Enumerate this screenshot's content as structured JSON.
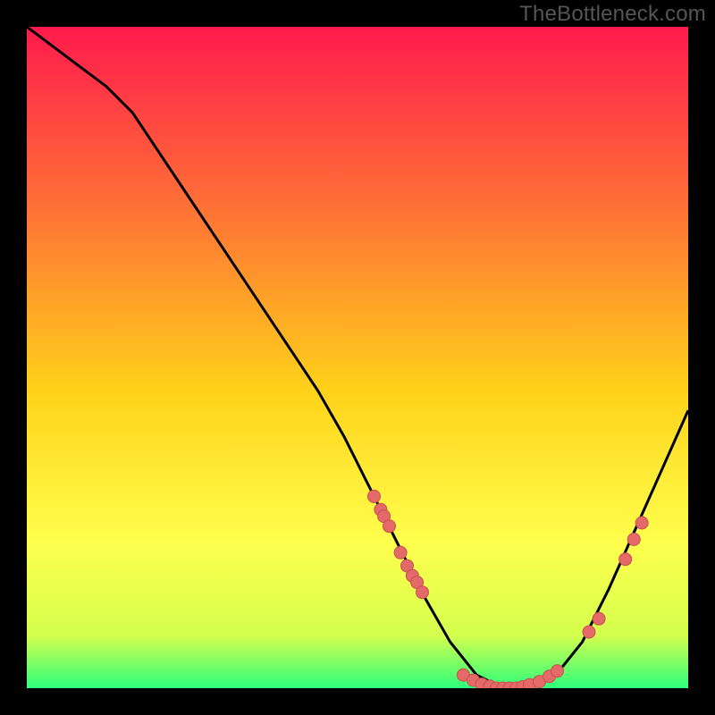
{
  "watermark": "TheBottleneck.com",
  "colors": {
    "bg": "#000000",
    "grad_top": "#ff1a4d",
    "grad_mid1": "#ff7a33",
    "grad_mid2": "#ffd21a",
    "grad_low": "#ffff4d",
    "grad_bottom1": "#d4ff4d",
    "grad_bottom2": "#2eff7a",
    "curve": "#000000",
    "dot_fill": "#e46a6a",
    "dot_stroke": "#c94f4f"
  },
  "chart_data": {
    "type": "line",
    "title": "",
    "xlabel": "",
    "ylabel": "",
    "xlim": [
      0,
      100
    ],
    "ylim": [
      0,
      100
    ],
    "series": [
      {
        "name": "bottleneck-curve",
        "x": [
          0,
          4,
          8,
          12,
          16,
          20,
          24,
          28,
          32,
          36,
          40,
          44,
          48,
          52,
          56,
          60,
          64,
          68,
          72,
          76,
          80,
          84,
          88,
          92,
          96,
          100
        ],
        "y": [
          100,
          97,
          94,
          91,
          87,
          81,
          75,
          69,
          63,
          57,
          51,
          45,
          38,
          30,
          22,
          14,
          7,
          2,
          0,
          0,
          2,
          7,
          15,
          24,
          33,
          42
        ]
      }
    ],
    "scatter": [
      {
        "name": "cluster-left-upper",
        "x": [
          52.5,
          53.5,
          54.0,
          54.8
        ],
        "y": [
          29.0,
          27.0,
          26.0,
          24.5
        ]
      },
      {
        "name": "cluster-left-lower",
        "x": [
          56.5,
          57.5,
          58.3,
          59.0,
          59.8
        ],
        "y": [
          20.5,
          18.5,
          17.0,
          16.0,
          14.5
        ]
      },
      {
        "name": "cluster-bottom",
        "x": [
          66.0,
          67.5,
          68.8,
          70.0,
          71.0,
          72.0,
          73.0,
          74.0,
          75.0,
          76.0,
          77.5,
          79.0,
          80.2
        ],
        "y": [
          2.0,
          1.2,
          0.6,
          0.3,
          0.0,
          0.0,
          0.0,
          0.0,
          0.2,
          0.5,
          1.0,
          1.8,
          2.6
        ]
      },
      {
        "name": "cluster-right",
        "x": [
          85.0,
          86.5,
          90.5,
          91.8,
          93.0
        ],
        "y": [
          8.5,
          10.5,
          19.5,
          22.5,
          25.0
        ]
      }
    ]
  }
}
